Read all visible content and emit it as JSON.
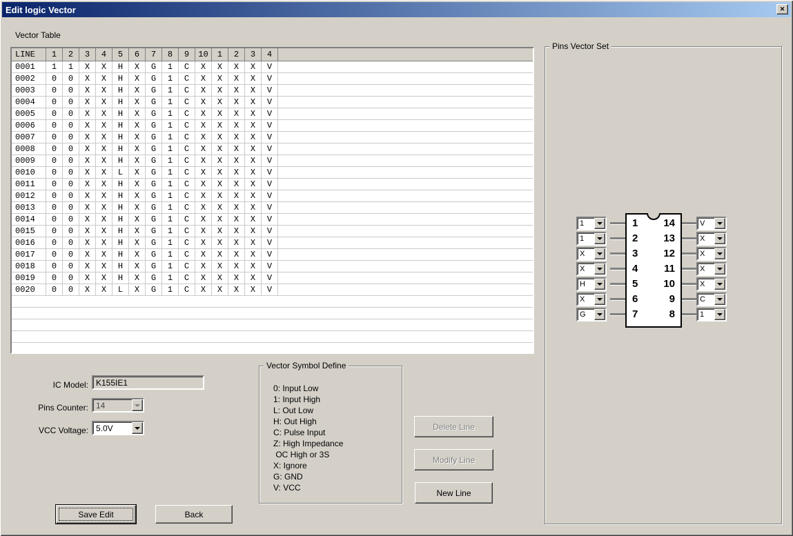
{
  "window": {
    "title": "Edit logic Vector",
    "close_glyph": "✕"
  },
  "vector_table": {
    "label": "Vector Table",
    "headers": [
      "LINE",
      "1",
      "2",
      "3",
      "4",
      "5",
      "6",
      "7",
      "8",
      "9",
      "10",
      "1",
      "2",
      "3",
      "4"
    ],
    "rows": [
      {
        "line": "0001",
        "values": [
          "1",
          "1",
          "X",
          "X",
          "H",
          "X",
          "G",
          "1",
          "C",
          "X",
          "X",
          "X",
          "X",
          "V"
        ]
      },
      {
        "line": "0002",
        "values": [
          "0",
          "0",
          "X",
          "X",
          "H",
          "X",
          "G",
          "1",
          "C",
          "X",
          "X",
          "X",
          "X",
          "V"
        ]
      },
      {
        "line": "0003",
        "values": [
          "0",
          "0",
          "X",
          "X",
          "H",
          "X",
          "G",
          "1",
          "C",
          "X",
          "X",
          "X",
          "X",
          "V"
        ]
      },
      {
        "line": "0004",
        "values": [
          "0",
          "0",
          "X",
          "X",
          "H",
          "X",
          "G",
          "1",
          "C",
          "X",
          "X",
          "X",
          "X",
          "V"
        ]
      },
      {
        "line": "0005",
        "values": [
          "0",
          "0",
          "X",
          "X",
          "H",
          "X",
          "G",
          "1",
          "C",
          "X",
          "X",
          "X",
          "X",
          "V"
        ]
      },
      {
        "line": "0006",
        "values": [
          "0",
          "0",
          "X",
          "X",
          "H",
          "X",
          "G",
          "1",
          "C",
          "X",
          "X",
          "X",
          "X",
          "V"
        ]
      },
      {
        "line": "0007",
        "values": [
          "0",
          "0",
          "X",
          "X",
          "H",
          "X",
          "G",
          "1",
          "C",
          "X",
          "X",
          "X",
          "X",
          "V"
        ]
      },
      {
        "line": "0008",
        "values": [
          "0",
          "0",
          "X",
          "X",
          "H",
          "X",
          "G",
          "1",
          "C",
          "X",
          "X",
          "X",
          "X",
          "V"
        ]
      },
      {
        "line": "0009",
        "values": [
          "0",
          "0",
          "X",
          "X",
          "H",
          "X",
          "G",
          "1",
          "C",
          "X",
          "X",
          "X",
          "X",
          "V"
        ]
      },
      {
        "line": "0010",
        "values": [
          "0",
          "0",
          "X",
          "X",
          "L",
          "X",
          "G",
          "1",
          "C",
          "X",
          "X",
          "X",
          "X",
          "V"
        ]
      },
      {
        "line": "0011",
        "values": [
          "0",
          "0",
          "X",
          "X",
          "H",
          "X",
          "G",
          "1",
          "C",
          "X",
          "X",
          "X",
          "X",
          "V"
        ]
      },
      {
        "line": "0012",
        "values": [
          "0",
          "0",
          "X",
          "X",
          "H",
          "X",
          "G",
          "1",
          "C",
          "X",
          "X",
          "X",
          "X",
          "V"
        ]
      },
      {
        "line": "0013",
        "values": [
          "0",
          "0",
          "X",
          "X",
          "H",
          "X",
          "G",
          "1",
          "C",
          "X",
          "X",
          "X",
          "X",
          "V"
        ]
      },
      {
        "line": "0014",
        "values": [
          "0",
          "0",
          "X",
          "X",
          "H",
          "X",
          "G",
          "1",
          "C",
          "X",
          "X",
          "X",
          "X",
          "V"
        ]
      },
      {
        "line": "0015",
        "values": [
          "0",
          "0",
          "X",
          "X",
          "H",
          "X",
          "G",
          "1",
          "C",
          "X",
          "X",
          "X",
          "X",
          "V"
        ]
      },
      {
        "line": "0016",
        "values": [
          "0",
          "0",
          "X",
          "X",
          "H",
          "X",
          "G",
          "1",
          "C",
          "X",
          "X",
          "X",
          "X",
          "V"
        ]
      },
      {
        "line": "0017",
        "values": [
          "0",
          "0",
          "X",
          "X",
          "H",
          "X",
          "G",
          "1",
          "C",
          "X",
          "X",
          "X",
          "X",
          "V"
        ]
      },
      {
        "line": "0018",
        "values": [
          "0",
          "0",
          "X",
          "X",
          "H",
          "X",
          "G",
          "1",
          "C",
          "X",
          "X",
          "X",
          "X",
          "V"
        ]
      },
      {
        "line": "0019",
        "values": [
          "0",
          "0",
          "X",
          "X",
          "H",
          "X",
          "G",
          "1",
          "C",
          "X",
          "X",
          "X",
          "X",
          "V"
        ]
      },
      {
        "line": "0020",
        "values": [
          "0",
          "0",
          "X",
          "X",
          "L",
          "X",
          "G",
          "1",
          "C",
          "X",
          "X",
          "X",
          "X",
          "V"
        ]
      }
    ]
  },
  "form": {
    "ic_model_label": "IC Model:",
    "ic_model_value": "K155IE1",
    "pins_counter_label": "Pins Counter:",
    "pins_counter_value": "14",
    "vcc_voltage_label": "VCC Voltage:",
    "vcc_voltage_value": "5.0V"
  },
  "symbol_define": {
    "title": "Vector Symbol Define",
    "lines": [
      "0: Input Low",
      "1: Input High",
      "L: Out Low",
      "H: Out High",
      "C: Pulse Input",
      "Z: High Impedance",
      " OC High or 3S",
      "X: Ignore",
      "G: GND",
      "V: VCC"
    ]
  },
  "buttons": {
    "delete_line": "Delete Line",
    "modify_line": "Modify Line",
    "new_line": "New Line",
    "save_edit": "Save Edit",
    "back": "Back"
  },
  "pins_vector_set": {
    "title": "Pins Vector Set",
    "left_pins": [
      {
        "pin": "1",
        "value": "1"
      },
      {
        "pin": "2",
        "value": "1"
      },
      {
        "pin": "3",
        "value": "X"
      },
      {
        "pin": "4",
        "value": "X"
      },
      {
        "pin": "5",
        "value": "H"
      },
      {
        "pin": "6",
        "value": "X"
      },
      {
        "pin": "7",
        "value": "G"
      }
    ],
    "right_pins": [
      {
        "pin": "14",
        "value": "V"
      },
      {
        "pin": "13",
        "value": "X"
      },
      {
        "pin": "12",
        "value": "X"
      },
      {
        "pin": "11",
        "value": "X"
      },
      {
        "pin": "10",
        "value": "X"
      },
      {
        "pin": "9",
        "value": "C"
      },
      {
        "pin": "8",
        "value": "1"
      }
    ]
  }
}
